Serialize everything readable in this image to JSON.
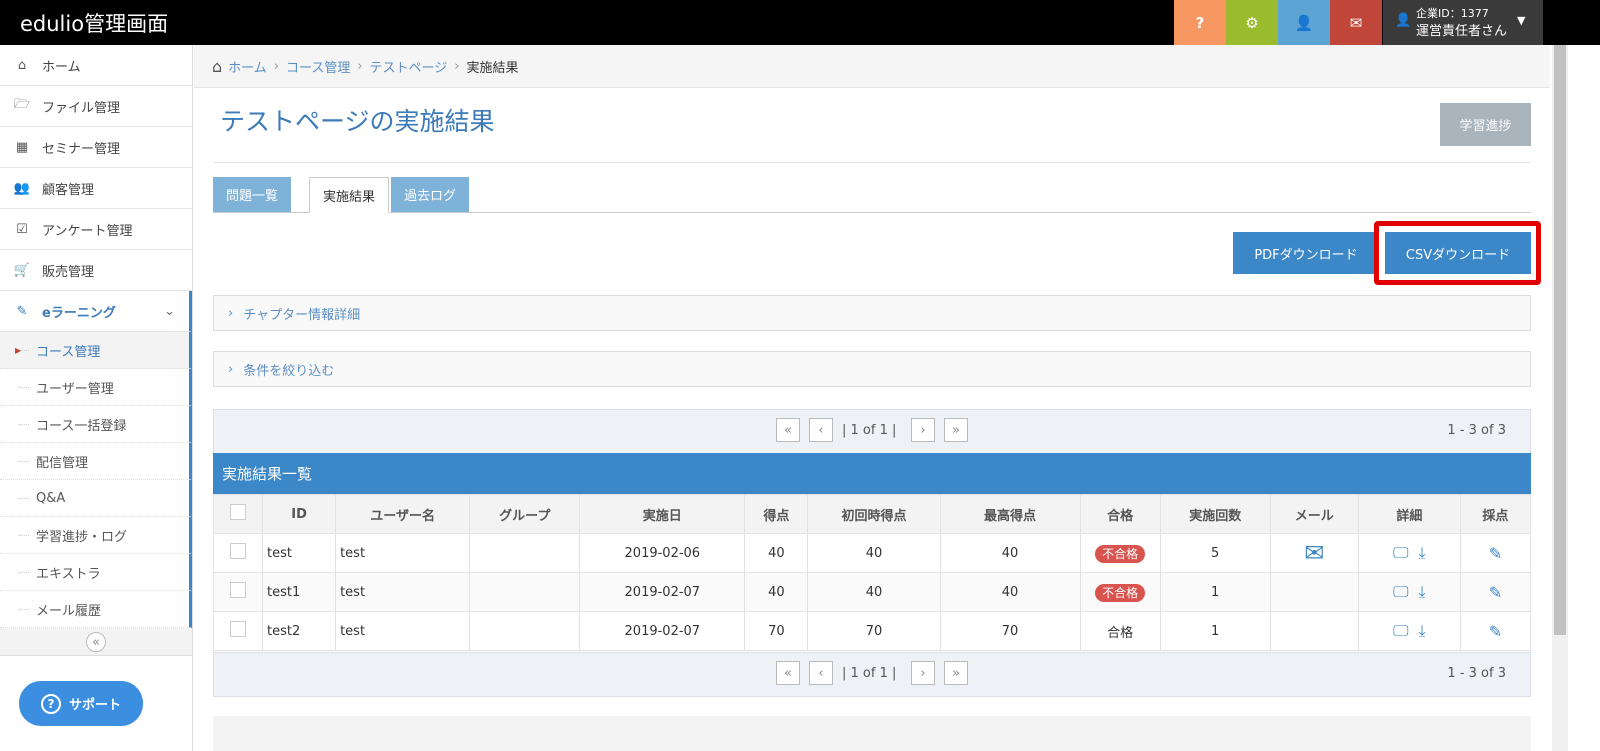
{
  "header": {
    "title": "edulio管理画面",
    "company_id": "企業ID：1377",
    "user_name": "運営責任者さん",
    "help": "?"
  },
  "sidebar": {
    "items": [
      {
        "label": "ホーム",
        "icon": "home-icon",
        "glyph": "⌂"
      },
      {
        "label": "ファイル管理",
        "icon": "folder-icon",
        "glyph": "🗁"
      },
      {
        "label": "セミナー管理",
        "icon": "calendar-icon",
        "glyph": "▦"
      },
      {
        "label": "顧客管理",
        "icon": "users-icon",
        "glyph": "👥"
      },
      {
        "label": "アンケート管理",
        "icon": "checkbox-icon",
        "glyph": "☑"
      },
      {
        "label": "販売管理",
        "icon": "cart-icon",
        "glyph": "🛒"
      }
    ],
    "section": "eラーニング",
    "sub_items": [
      "コース管理",
      "ユーザー管理",
      "コース一括登録",
      "配信管理",
      "Q&A",
      "学習進捗・ログ",
      "エキストラ",
      "メール履歴"
    ],
    "collapse": "«",
    "support": "サポート"
  },
  "breadcrumb": [
    "ホーム",
    "コース管理",
    "テストページ",
    "実施結果"
  ],
  "page": {
    "title": "テストページの実施結果",
    "progress_button": "学習進捗"
  },
  "tabs": [
    "問題一覧",
    "実施結果",
    "過去ログ"
  ],
  "buttons": {
    "pdf": "PDFダウンロード",
    "csv": "CSVダウンロード"
  },
  "accordions": [
    "チャプター情報詳細",
    "条件を絞り込む"
  ],
  "pager": {
    "first": "«",
    "prev": "‹",
    "label": "| 1 of 1 |",
    "next": "›",
    "last": "»",
    "range": "1 - 3 of 3"
  },
  "table": {
    "title": "実施結果一覧",
    "headers": [
      "ID",
      "ユーザー名",
      "グループ",
      "実施日",
      "得点",
      "初回時得点",
      "最高得点",
      "合格",
      "実施回数",
      "メール",
      "詳細",
      "採点"
    ],
    "rows": [
      {
        "id": "test",
        "user": "test",
        "group": "",
        "date": "2019-02-06",
        "score": "40",
        "first": "40",
        "max": "40",
        "pass": "不合格",
        "fail": true,
        "count": "5",
        "mail": true
      },
      {
        "id": "test1",
        "user": "test",
        "group": "",
        "date": "2019-02-07",
        "score": "40",
        "first": "40",
        "max": "40",
        "pass": "不合格",
        "fail": true,
        "count": "1",
        "mail": false
      },
      {
        "id": "test2",
        "user": "test",
        "group": "",
        "date": "2019-02-07",
        "score": "70",
        "first": "70",
        "max": "70",
        "pass": "合格",
        "fail": false,
        "count": "1",
        "mail": false
      }
    ]
  },
  "colors": {
    "help": "#f79862",
    "settings": "#9bbb2e",
    "user": "#5ba4d4",
    "mail": "#c0463a",
    "primary": "#3c87c8",
    "highlight": "#e00000"
  }
}
